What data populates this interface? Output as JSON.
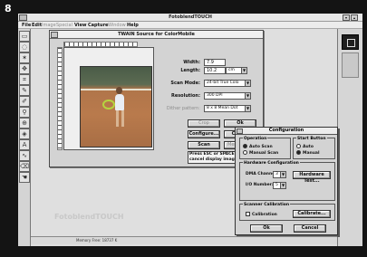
{
  "figure_number": "8",
  "app": {
    "title": "FotoblendTOUCH",
    "menu": [
      "File",
      "Edit",
      "Image",
      "Special",
      "View",
      "Capture",
      "Window",
      "Help"
    ],
    "menu_disabled": [
      false,
      false,
      true,
      true,
      false,
      false,
      true,
      false
    ]
  },
  "twain": {
    "title": "TWAIN Source for ColorMobile",
    "width_label": "Width:",
    "width_value": "7.9",
    "length_label": "Length:",
    "length_value": "10.2",
    "unit": "cm",
    "scan_mode_label": "Scan Mode:",
    "scan_mode_value": "24-bit True Colo",
    "resolution_label": "Resolution:",
    "resolution_value": "300 DPI",
    "dither_label": "Dither pattern:",
    "dither_value": "8 x 8 Mean Dot",
    "buttons": {
      "crop": "Crop",
      "ok": "Ok",
      "configure": "Configure...",
      "cancel": "Cancel",
      "scan": "Scan",
      "merge": "Merge Scans"
    },
    "hint": "Press ESC or SPACE key to cancel display image."
  },
  "config": {
    "title": "Configuration",
    "operation_title": "Operation",
    "auto_scan": "Auto Scan",
    "manual_scan": "Manual Scan",
    "start_button_title": "Start Button",
    "start_auto": "Auto",
    "start_manual": "Manual",
    "hardware_title": "Hardware Configuration",
    "dma_label": "DMA Channel:",
    "dma_value": "3",
    "io_label": "I/O Number:",
    "io_value": "5",
    "hardware_test": "Hardware Test...",
    "calib_title": "Scanner Calibration",
    "calibration": "Calibration",
    "calibrate": "Calibrate...",
    "ok": "Ok",
    "cancel": "Cancel"
  },
  "status": {
    "memory": "Memory Free: 18737 K"
  },
  "ghost_text": "FotoblendTOUCH"
}
